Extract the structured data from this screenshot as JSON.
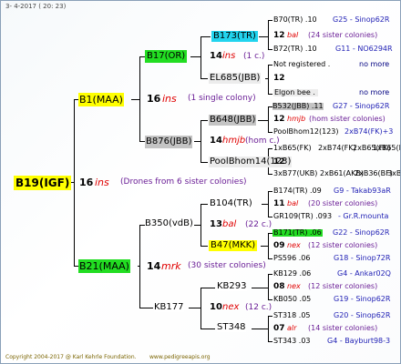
{
  "header": {
    "date": "3- 4-2017 ( 20: 23)"
  },
  "root": {
    "name": "B19(IGF)",
    "gen": "16",
    "breed": "ins",
    "colony": "(Drones from 6 sister colonies)"
  },
  "sire": {
    "name": "B1(MAA)",
    "gen": "16",
    "breed": "ins",
    "colony": "(1 single colony)"
  },
  "dam": {
    "name": "B21(MAA)",
    "gen": "14",
    "breed": "mrk",
    "colony": "(30 sister colonies)"
  },
  "sire_sire": {
    "name": "B17(OR)",
    "gen": "14",
    "breed": "ins",
    "colony": "(1 c.)"
  },
  "sire_dam": {
    "name": "B876(JBB)",
    "gen": "14",
    "breed": "hmjb",
    "colony": "(hom c.)"
  },
  "dam_sire": {
    "name": "B350(vdB)",
    "gen": "13",
    "breed": "bal",
    "colony": "(22 c.)"
  },
  "dam_dam": {
    "name": "KB177",
    "gen": "10",
    "breed": "nex",
    "colony": "(12 c.)"
  },
  "g3": {
    "b173": "B173(TR)",
    "el685": "EL685(JBB)",
    "b648": "B648(JBB)",
    "poolbhom": "PoolBhom14(123)",
    "b104": "B104(TR)",
    "b47": "B47(MKK)",
    "kb293": "KB293",
    "st348": "ST348"
  },
  "right": {
    "r1": {
      "a": "B70(TR) .10",
      "b": "G25 - Sinop62R"
    },
    "r2": {
      "gen": "12",
      "breed": "bal",
      "colony": "(24 sister colonies)"
    },
    "r3": {
      "a": "B72(TR) .10",
      "b": "G11 - NO6294R"
    },
    "r4": {
      "a": "Not registered .",
      "b": "no more"
    },
    "r5": {
      "gen": "12"
    },
    "r6": {
      "a": "Elgon bee .",
      "b": "no more"
    },
    "r7": {
      "a": "B532(JBB) .11",
      "b": "G27 - Sinop62R"
    },
    "r8": {
      "gen": "12",
      "breed": "hmjb",
      "colony": "(hom sister colonies)"
    },
    "r9": {
      "a": "PoolBhom12(123)",
      "b": "2xB74(FK)+3"
    },
    "r10": {
      "a": "1xB65(FK)",
      "b": "2xB74(FK)",
      "c": "2xB65(FK)",
      "d": "1xB65(RS"
    },
    "r11": {
      "gen": "12"
    },
    "r12": {
      "a": "3xB77(UKB)",
      "b": "2xB61(AKB)",
      "c": "2xB36(BF)",
      "d": "3xB"
    },
    "r13": {
      "a": "B174(TR) .09",
      "b": "G9 - Takab93aR"
    },
    "r14": {
      "gen": "11",
      "breed": "bal",
      "colony": "(20 sister colonies)"
    },
    "r15": {
      "a": "GR109(TR) .093",
      "b": "- Gr.R.mounta"
    },
    "r16": {
      "a": "B171(TR) .06",
      "b": "G22 - Sinop62R"
    },
    "r17": {
      "gen": "09",
      "breed": "nex",
      "colony": "(12 sister colonies)"
    },
    "r18": {
      "a": "PS596 .06",
      "b": "G18 - Sinop72R"
    },
    "r19": {
      "a": "KB129 .06",
      "b": "G4 - Ankar02Q"
    },
    "r20": {
      "gen": "08",
      "breed": "nex",
      "colony": "(12 sister colonies)"
    },
    "r21": {
      "a": "KB050 .05",
      "b": "G19 - Sinop62R"
    },
    "r22": {
      "a": "ST318 .05",
      "b": "G20 - Sinop62R"
    },
    "r23": {
      "gen": "07",
      "breed": "alr",
      "colony": "(14 sister colonies)"
    },
    "r24": {
      "a": "ST343 .03",
      "b": "G4 - Bayburt98-3"
    }
  },
  "footer": {
    "copyright": "Copyright 2004-2017 @ Karl Kehrle Foundation.",
    "url": "www.pedigreeapis.org"
  }
}
